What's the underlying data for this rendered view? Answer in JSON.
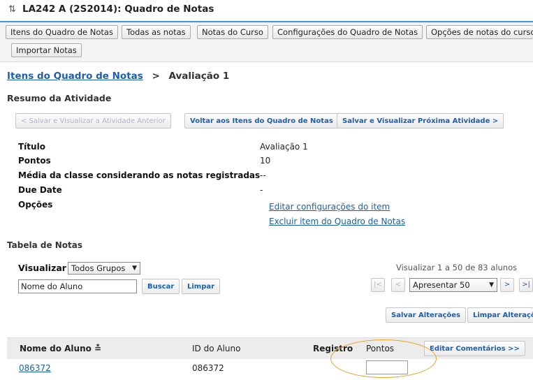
{
  "window": {
    "title": "LA242 A (2S2014): Quadro de Notas"
  },
  "toolbar": {
    "items": [
      "Itens do Quadro de Notas",
      "Todas as notas",
      "Notas do Curso",
      "Configurações do Quadro de Notas",
      "Opções de notas do curso",
      "Importar Notas"
    ]
  },
  "breadcrumb": {
    "parent": "Itens do Quadro de Notas",
    "separator": ">",
    "current": "Avaliação 1"
  },
  "section": {
    "title": "Resumo da Atividade"
  },
  "actions": {
    "prev": "< Salvar e Visualizar a Atividade Anterior",
    "back": "Voltar aos Itens do Quadro de Notas",
    "next": "Salvar e Visualizar  Próxima Atividade >"
  },
  "details": {
    "rows": [
      {
        "label": "Título",
        "value": "Avaliação 1"
      },
      {
        "label": "Pontos",
        "value": "10"
      },
      {
        "label": "Média da classe considerando as notas registradas",
        "value": "--"
      },
      {
        "label": "Due Date",
        "value": "-"
      },
      {
        "label": "Opções",
        "value": ""
      }
    ],
    "options": [
      "Editar configurações do item",
      "Excluir item do Quadro de Notas"
    ]
  },
  "table": {
    "title": "Tabela de Notas",
    "view_label": "Visualizar",
    "view_selected": "Todos Grupos",
    "search_value": "Nome do Aluno",
    "search_button": "Buscar",
    "clear_button": "Limpar",
    "pager_info": "Visualizar 1 a 50 de 83 alunos",
    "page_size_selected": "Apresentar 50",
    "pager": {
      "first": "|<",
      "prev": "<",
      "next": ">",
      "last": ">|"
    },
    "save_changes": "Salvar Alterações",
    "clear_changes": "Limpar Alterações",
    "columns": {
      "name": "Nome do Aluno",
      "sort_icon": "≛",
      "id": "ID do Aluno",
      "registro": "Registro",
      "points": "Pontos",
      "edit_comments": "Editar Comentários >>"
    },
    "rows": [
      {
        "name": "086372",
        "id": "086372",
        "registro": "",
        "points": ""
      }
    ]
  },
  "colors": {
    "accent": "#3a9ad9",
    "link": "#1a5fb4",
    "highlight": "#f0a020"
  },
  "icons": {
    "title": "sync-arrows-icon",
    "dropdown": "triangle-down-icon"
  }
}
